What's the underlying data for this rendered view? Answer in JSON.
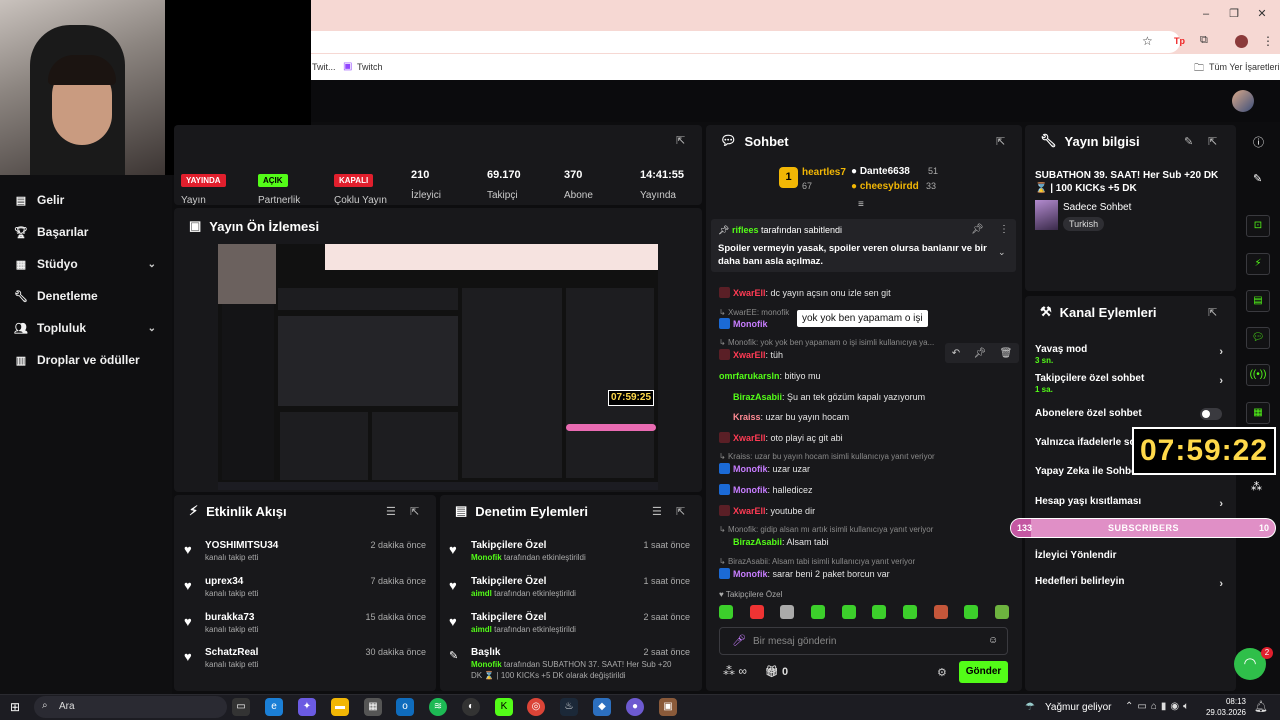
{
  "browser": {
    "bookmark_twitch": "Twitch",
    "bookmark_truncated": "Twit...",
    "all_bookmarks": "Tüm Yer İşaretleri"
  },
  "sidebar": {
    "items": [
      {
        "label": "Gelir",
        "icon": "revenue-icon"
      },
      {
        "label": "Başarılar",
        "icon": "trophy-icon"
      },
      {
        "label": "Stüdyo",
        "icon": "studio-icon"
      },
      {
        "label": "Denetleme",
        "icon": "wrench-icon"
      },
      {
        "label": "Topluluk",
        "icon": "community-icon"
      },
      {
        "label": "Droplar ve ödüller",
        "icon": "drops-icon"
      }
    ]
  },
  "stats": {
    "live_badge": "YAYINDA",
    "live_label": "Yayın",
    "partner_badge": "AÇIK",
    "partner_label": "Partnerlik",
    "multi_badge": "KAPALI",
    "multi_label": "Çoklu Yayın",
    "viewers": "210",
    "viewers_label": "İzleyici",
    "followers": "69.170",
    "followers_label": "Takipçi",
    "subs": "370",
    "subs_label": "Abone",
    "uptime": "14:41:55",
    "uptime_label": "Yayında"
  },
  "preview": {
    "title": "Yayın Ön İzlemesi",
    "timer": "07:59:25"
  },
  "activity": {
    "title": "Etkinlik Akışı",
    "items": [
      {
        "name": "YOSHIMITSU34",
        "sub": "kanalı takip etti",
        "time": "2 dakika önce"
      },
      {
        "name": "uprex34",
        "sub": "kanalı takip etti",
        "time": "7 dakika önce"
      },
      {
        "name": "burakka73",
        "sub": "kanalı takip etti",
        "time": "15 dakika önce"
      },
      {
        "name": "SchatzReal",
        "sub": "kanalı takip etti",
        "time": "30 dakika önce"
      }
    ]
  },
  "mod": {
    "title": "Denetim Eylemleri",
    "items": [
      {
        "title": "Takipçilere Özel",
        "user": "Monofik",
        "sub": "tarafından etkinleştirildi",
        "time": "1 saat önce"
      },
      {
        "title": "Takipçilere Özel",
        "user": "aimdl",
        "sub": "tarafından etkinleştirildi",
        "time": "1 saat önce"
      },
      {
        "title": "Takipçilere Özel",
        "user": "aimdl",
        "sub": "tarafından etkinleştirildi",
        "time": "2 saat önce"
      },
      {
        "title": "Başlık",
        "user": "Monofik",
        "sub": "tarafından SUBATHON 37. SAAT! Her Sub +20",
        "sub2": "DK ⌛ | 100 KICKs +5 DK olarak değiştirildi",
        "time": "2 saat önce"
      }
    ]
  },
  "chat": {
    "title": "Sohbet",
    "leaders": [
      {
        "rank": "1",
        "name": "heartles7",
        "count": "67"
      },
      {
        "name": "Dante6638",
        "count": "51"
      },
      {
        "name": "cheesybirdd",
        "count": "33"
      }
    ],
    "pinned_by": "riflees",
    "pinned_suffix": "tarafından sabitlendi",
    "pinned_text": "Spoiler vermeyin yasak, spoiler veren olursa banlanır ve bir daha banı asla açılmaz.",
    "tooltip": "yok yok ben yapamam o işi",
    "messages": [
      {
        "user": "XwarEll",
        "color": "#ff3b54",
        "text": "dc yayın açsın onu izle sen git"
      },
      {
        "reply": "XwarEE: monofik"
      },
      {
        "user": "Monofik",
        "color": "#c77dff",
        "text": ""
      },
      {
        "reply": "Monofik: yok yok ben yapamam o işi isimli kullanıcıya ya..."
      },
      {
        "user": "XwarEll",
        "color": "#ff3b54",
        "text": "tüh"
      },
      {
        "user": "omrfarukarsln",
        "color": "#53fc18",
        "text": "bitiyo mu"
      },
      {
        "user": "BirazAsabii",
        "color": "#53fc18",
        "text": "Şu an tek gözüm kapalı yazıyorum"
      },
      {
        "user": "Kraiss",
        "color": "#ff8b94",
        "text": "uzar bu yayın hocam"
      },
      {
        "user": "XwarEll",
        "color": "#ff3b54",
        "text": "oto playi aç git abi"
      },
      {
        "reply": "Kraiss: uzar bu yayın hocam isimli kullanıcıya yanıt veriyor"
      },
      {
        "user": "Monofik",
        "color": "#c77dff",
        "text": "uzar uzar"
      },
      {
        "user": "Monofik",
        "color": "#c77dff",
        "text": "halledicez"
      },
      {
        "user": "XwarEll",
        "color": "#ff3b54",
        "text": "youtube dir"
      },
      {
        "reply": "Monofik: gidip alsan mı artık isimli kullanıcıya yanıt veriyor"
      },
      {
        "user": "BirazAsabii",
        "color": "#53fc18",
        "text": "Alsam tabi"
      },
      {
        "reply": "BirazAsabii: Alsam tabi isimli kullanıcıya yanıt veriyor"
      },
      {
        "user": "Monofik",
        "color": "#c77dff",
        "text": "sarar beni 2 paket borcun var"
      }
    ],
    "followers_only": "Takipçilere Özel",
    "input_placeholder": "Bir mesaj gönderin",
    "infinity": "∞",
    "coins": "0",
    "send": "Gönder"
  },
  "stream_info": {
    "title": "Yayın bilgisi",
    "stream_title": "SUBATHON 39. SAAT! Her Sub +20 DK ⌛ | 100 KICKs +5 DK",
    "category": "Sadece Sohbet",
    "tag": "Turkish"
  },
  "channel_actions": {
    "title": "Kanal Eylemleri",
    "items": [
      {
        "label": "Yavaş mod",
        "sub": "3 sn."
      },
      {
        "label": "Takipçilere özel sohbet",
        "sub": "1 sa."
      },
      {
        "label": "Abonelere özel sohbet",
        "sub": ""
      },
      {
        "label": "Yalnızca ifadelerle sohbet",
        "sub": ""
      },
      {
        "label": "Yapay Zeka ile Sohbet",
        "sub": ""
      },
      {
        "label": "Hesap yaşı kısıtlaması",
        "sub": ""
      },
      {
        "label": "İzleyici Yönlendir",
        "sub": ""
      },
      {
        "label": "Hedefleri belirleyin",
        "sub": ""
      }
    ]
  },
  "overlay": {
    "timer": "07:59:22",
    "subs_left": "133",
    "subs_label": "SUBSCRIBERS",
    "subs_right": "10",
    "notif_count": "2"
  },
  "taskbar": {
    "search": "Ara",
    "weather": "Yağmur geliyor",
    "time": "08:13",
    "date": "29.03.2026"
  },
  "colors": {
    "accent": "#53fc18",
    "panel": "#18181b",
    "live": "#e11f2d"
  }
}
